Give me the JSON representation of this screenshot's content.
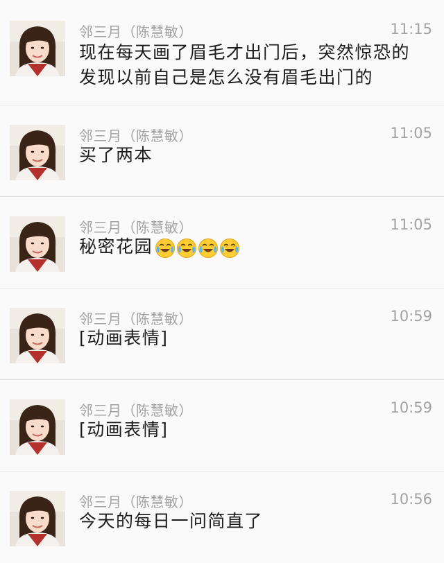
{
  "messages": [
    {
      "sender": "邻三月（陈慧敏）",
      "time": "11:15",
      "text": "现在每天画了眉毛才出门后，突然惊恐的发现以前自己是怎么没有眉毛出门的"
    },
    {
      "sender": "邻三月（陈慧敏）",
      "time": "11:05",
      "text": "买了两本"
    },
    {
      "sender": "邻三月（陈慧敏）",
      "time": "11:05",
      "text": "秘密花园",
      "emojis": [
        "laughing-crying-emoji",
        "laughing-crying-emoji",
        "laughing-crying-emoji",
        "laughing-crying-emoji"
      ]
    },
    {
      "sender": "邻三月（陈慧敏）",
      "time": "10:59",
      "text": "[动画表情]"
    },
    {
      "sender": "邻三月（陈慧敏）",
      "time": "10:59",
      "text": "[动画表情]"
    },
    {
      "sender": "邻三月（陈慧敏）",
      "time": "10:56",
      "text": "今天的每日一问简直了"
    }
  ]
}
